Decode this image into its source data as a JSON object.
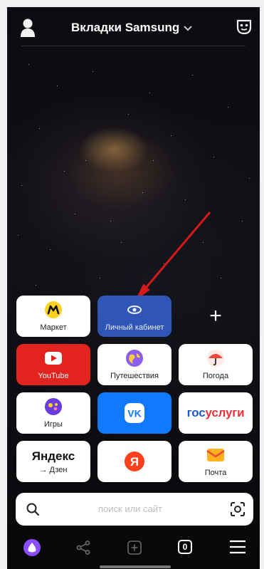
{
  "header": {
    "title": "Вкладки Samsung",
    "chevron": "⌄",
    "profile_icon": "profile-icon",
    "incognito_icon": "incognito-mask-icon"
  },
  "tiles": [
    {
      "id": "market",
      "label": "Маркет"
    },
    {
      "id": "lk",
      "label": "Личный кабинет"
    },
    {
      "id": "add",
      "label": "+"
    },
    {
      "id": "youtube",
      "label": "YouTube"
    },
    {
      "id": "travel",
      "label": "Путешествия"
    },
    {
      "id": "weather",
      "label": "Погода"
    },
    {
      "id": "games",
      "label": "Игры"
    },
    {
      "id": "vk",
      "label": "VK"
    },
    {
      "id": "gosuslugi",
      "label_gos": "гос",
      "label_uslugi": "услуги"
    },
    {
      "id": "yandex",
      "label_main": "Яндекс",
      "label_sub": "→ Дзен"
    },
    {
      "id": "ya",
      "label": "Я"
    },
    {
      "id": "mail",
      "label": "Почта"
    }
  ],
  "search": {
    "placeholder": "поиск или сайт"
  },
  "bottom_nav": {
    "tabs_count": "0"
  },
  "colors": {
    "youtube_red": "#e3231e",
    "lk_blue": "#2f55b6",
    "vk_blue": "#0f7aff",
    "gos_blue": "#1c5cc8",
    "gos_red": "#e7323c",
    "alice_purple": "#8a4dff",
    "arrow_red": "#d31a1a"
  }
}
